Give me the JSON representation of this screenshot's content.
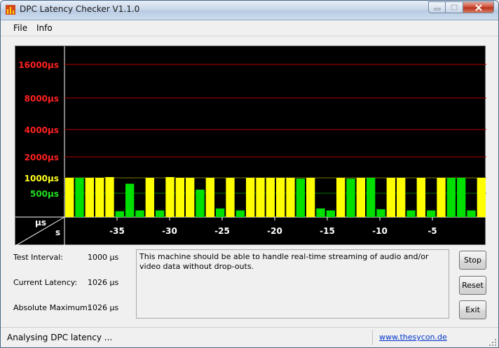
{
  "window": {
    "title": "DPC Latency Checker V1.1.0"
  },
  "menu": [
    "File",
    "Info"
  ],
  "graph": {
    "y_labels": [
      {
        "text": "16000µs",
        "color": "#ff2020"
      },
      {
        "text": "8000µs",
        "color": "#ff2020"
      },
      {
        "text": "4000µs",
        "color": "#ff2020"
      },
      {
        "text": "2000µs",
        "color": "#ff2020"
      },
      {
        "text": "1000µs",
        "color": "#ffff20"
      },
      {
        "text": "500µs",
        "color": "#20e020"
      }
    ],
    "corner_top": "µs",
    "corner_bottom": "s",
    "x_ticks": [
      "-35",
      "-30",
      "-25",
      "-20",
      "-15",
      "-10",
      "-5"
    ],
    "bar_colors": {
      "yellow": "#ffff00",
      "green": "#00e000"
    },
    "bars": [
      {
        "color": "yellow",
        "level": 1.0
      },
      {
        "color": "green",
        "level": 1.0
      },
      {
        "color": "yellow",
        "level": 1.0
      },
      {
        "color": "yellow",
        "level": 1.0
      },
      {
        "color": "yellow",
        "level": 1.02
      },
      {
        "color": "green",
        "level": 0.15
      },
      {
        "color": "green",
        "level": 0.85
      },
      {
        "color": "green",
        "level": 0.17
      },
      {
        "color": "yellow",
        "level": 1.0
      },
      {
        "color": "green",
        "level": 0.17
      },
      {
        "color": "yellow",
        "level": 1.02
      },
      {
        "color": "yellow",
        "level": 1.0
      },
      {
        "color": "yellow",
        "level": 1.0
      },
      {
        "color": "green",
        "level": 0.7
      },
      {
        "color": "yellow",
        "level": 1.0
      },
      {
        "color": "green",
        "level": 0.22
      },
      {
        "color": "yellow",
        "level": 1.0
      },
      {
        "color": "green",
        "level": 0.17
      },
      {
        "color": "yellow",
        "level": 1.0
      },
      {
        "color": "yellow",
        "level": 1.0
      },
      {
        "color": "yellow",
        "level": 1.0
      },
      {
        "color": "yellow",
        "level": 1.0
      },
      {
        "color": "yellow",
        "level": 1.0
      },
      {
        "color": "green",
        "level": 0.98
      },
      {
        "color": "yellow",
        "level": 1.0
      },
      {
        "color": "green",
        "level": 0.22
      },
      {
        "color": "green",
        "level": 0.17
      },
      {
        "color": "yellow",
        "level": 1.0
      },
      {
        "color": "green",
        "level": 0.98
      },
      {
        "color": "yellow",
        "level": 1.0
      },
      {
        "color": "green",
        "level": 1.0
      },
      {
        "color": "green",
        "level": 0.2
      },
      {
        "color": "yellow",
        "level": 1.0
      },
      {
        "color": "yellow",
        "level": 1.0
      },
      {
        "color": "green",
        "level": 0.17
      },
      {
        "color": "yellow",
        "level": 1.0
      },
      {
        "color": "green",
        "level": 0.17
      },
      {
        "color": "yellow",
        "level": 1.0
      },
      {
        "color": "green",
        "level": 1.0
      },
      {
        "color": "green",
        "level": 1.0
      },
      {
        "color": "green",
        "level": 0.17
      },
      {
        "color": "yellow",
        "level": 1.0
      }
    ]
  },
  "info": {
    "test_interval_label": "Test Interval:",
    "test_interval_value": "1000 µs",
    "current_latency_label": "Current Latency:",
    "current_latency_value": "1026 µs",
    "absolute_maximum_label": "Absolute Maximum:",
    "absolute_maximum_value": "1026 µs"
  },
  "message": "This machine should be able to handle real-time streaming of audio and/or video data without drop-outs.",
  "buttons": {
    "stop": "Stop",
    "reset": "Reset",
    "exit": "Exit"
  },
  "status": {
    "text": "Analysing DPC latency ...",
    "link": "www.thesycon.de"
  }
}
